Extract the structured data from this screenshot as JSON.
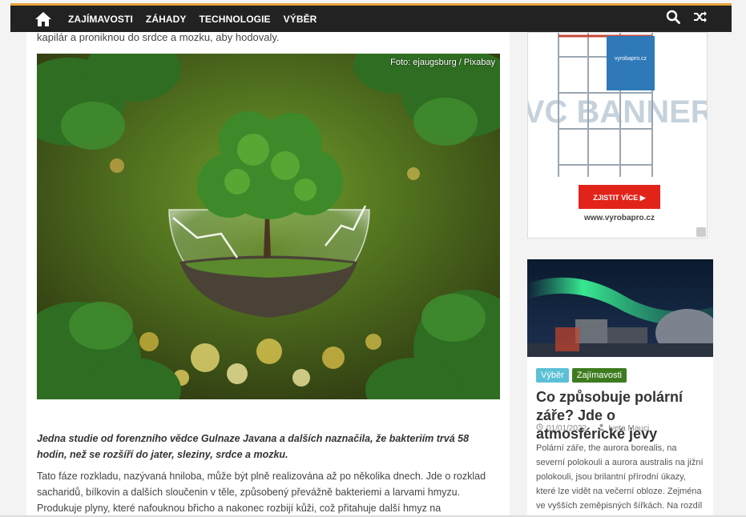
{
  "nav": {
    "home_icon": "home-icon",
    "items": [
      {
        "label": "ZAJÍMAVOSTI"
      },
      {
        "label": "ZÁHADY"
      },
      {
        "label": "TECHNOLOGIE"
      },
      {
        "label": "VÝBĚR"
      }
    ],
    "search_icon": "search-icon",
    "random_icon": "shuffle-icon",
    "accent": "#e8a33d",
    "bg": "#222222"
  },
  "article": {
    "intro": "kapilár a proniknou do srdce a mozku, aby hodovaly.",
    "image_credit": "Foto: ejaugsburg / Pixabay",
    "quote": "Jedna studie od forenzního vědce Gulnaze Javana a dalších naznačila, že bakteriím trvá 58 hodin, než se rozšíří do jater, sleziny, srdce a mozku.",
    "paragraph": "Tato fáze rozkladu, nazývaná hniloba, může být plně realizována až po několika dnech. Jde o rozklad sacharidů, bílkovin a dalších sloučenin v těle, způsobený převážně bakteriemi a larvami hmyzu. Produkuje plyny, které nafouknou břicho a nakonec rozbijí kůži, což přitahuje další hmyz na"
  },
  "ad": {
    "bg_text": "PVC BANNERY",
    "sign_text": "vyrobapro.cz",
    "button": "ZJISTIT VÍCE ▶",
    "url": "www.vyrobapro.cz",
    "button_color": "#e2231a"
  },
  "card": {
    "tags": [
      {
        "label": "Výběr",
        "color": "#5bc0d6"
      },
      {
        "label": "Zajímavosti",
        "color": "#3d7b1f"
      }
    ],
    "title": "Co způsobuje polární záře? Jde o atmosférické jevy",
    "date": "01/01/2022",
    "author": "Iveta Mauci",
    "excerpt": "Polární záře, the aurora borealis, na severní polokouli a aurora australis na jižní polokouli, jsou brilantní přírodní úkazy, které lze vidět na večerní obloze. Zejména ve vyšších zeměpisných šířkách. Na rozdíl od jiných jevů noční oblohy, jako jsou"
  }
}
